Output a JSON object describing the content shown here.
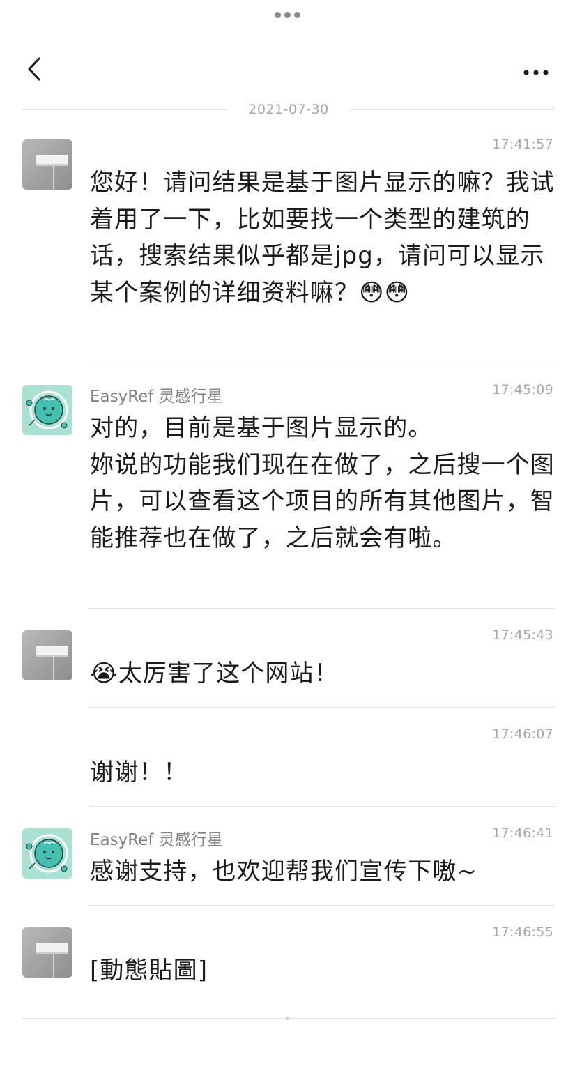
{
  "date_divider": "2021-07-30",
  "icons": {
    "back": "chevron-left-icon",
    "more": "more-horizontal-icon",
    "handle": "drag-handle-icon",
    "emoji_blush": "blushing-face-emoji",
    "emoji_cry": "loudly-crying-face-emoji"
  },
  "colors": {
    "background": "#ffffff",
    "timestamp": "#a6a6a6",
    "sender": "#808080",
    "divider": "#e2e2e2",
    "bot_avatar_bg": "#a9e2d3"
  },
  "messages": [
    {
      "sender": "",
      "time": "17:41:57",
      "text": "您好！请问结果是基于图片显示的嘛？我试着用了一下，比如要找一个类型的建筑的话，搜索结果似乎都是jpg，请问可以显示某个案例的详细资料嘛？😳😳"
    },
    {
      "sender": "EasyRef 灵感行星",
      "time": "17:45:09",
      "text": "对的，目前是基于图片显示的。\n妳说的功能我们现在在做了，之后搜一个图片，可以查看这个项目的所有其他图片，智能推荐也在做了，之后就会有啦。"
    },
    {
      "sender": "",
      "time": "17:45:43",
      "text": "😭太厉害了这个网站！"
    },
    {
      "sender": "",
      "time": "17:46:07",
      "text": "谢谢！！"
    },
    {
      "sender": "EasyRef 灵感行星",
      "time": "17:46:41",
      "text": "感谢支持，也欢迎帮我们宣传下嗷~"
    },
    {
      "sender": "",
      "time": "17:46:55",
      "text": "[動態貼圖]"
    }
  ]
}
